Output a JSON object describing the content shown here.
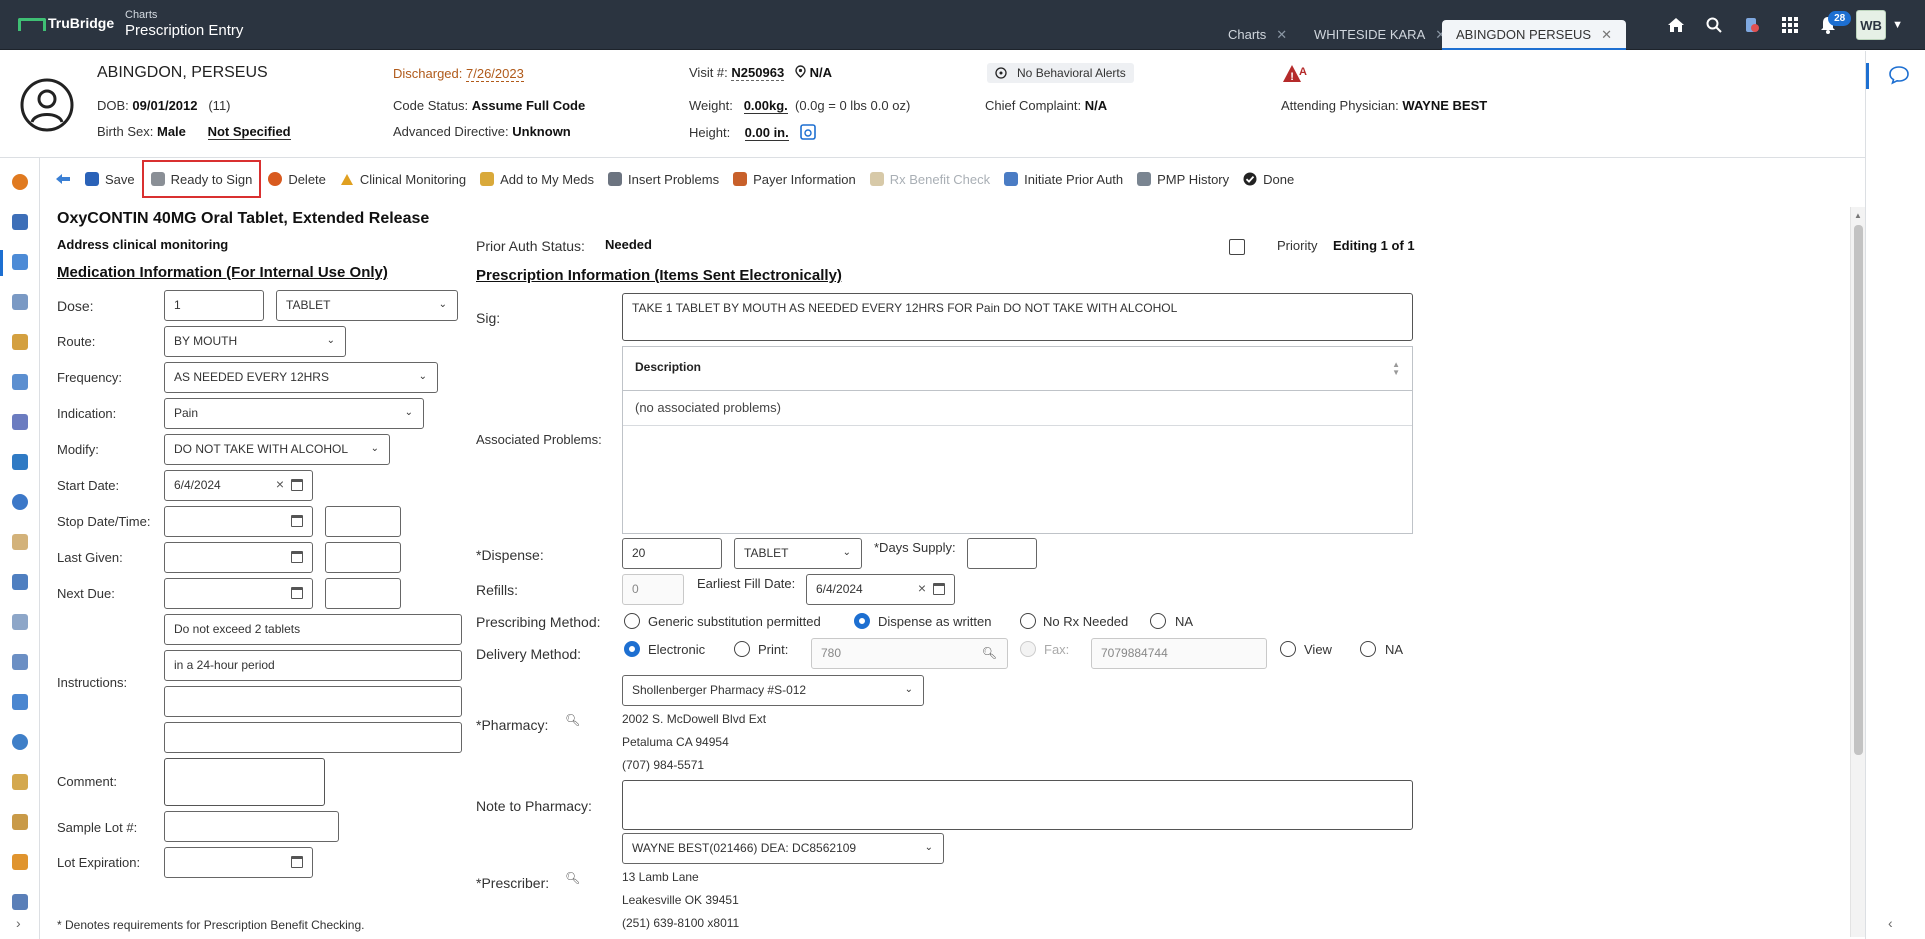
{
  "app": {
    "brand": "TruBridge",
    "module_small": "Charts",
    "module_title": "Prescription Entry"
  },
  "tabs": [
    {
      "label": "Charts"
    },
    {
      "label": "WHITESIDE KARA"
    },
    {
      "label": "ABINGDON PERSEUS",
      "active": true
    }
  ],
  "top_icons": {
    "notifications_count": "28",
    "user_initials": "WB"
  },
  "patient": {
    "last_name": "ABINGDON",
    "first_name": ", PERSEUS",
    "dob_label": "DOB:",
    "dob": "09/01/2012",
    "age": "(11)",
    "birth_sex_label": "Birth Sex:",
    "birth_sex": "Male",
    "gender": "Not Specified",
    "discharged_label": "Discharged:",
    "discharged_date": "7/26/2023",
    "code_status_label": "Code Status:",
    "code_status": "Assume Full Code",
    "adv_directive_label": "Advanced Directive:",
    "adv_directive": "Unknown",
    "visit_label": "Visit #:",
    "visit": "N250963",
    "location": "N/A",
    "weight_label": "Weight:",
    "weight": "0.00kg.",
    "weight_note": "(0.0g = 0 lbs 0.0 oz)",
    "height_label": "Height:",
    "height": "0.00 in.",
    "behavioral": "No Behavioral Alerts",
    "chief_complaint_label": "Chief Complaint:",
    "chief_complaint": "N/A",
    "attending_label": "Attending Physician:",
    "attending": "WAYNE BEST"
  },
  "toolbar": [
    {
      "label": "Save",
      "name": "save-button",
      "color": "#2a62b8"
    },
    {
      "label": "Ready to Sign",
      "name": "ready-to-sign-button",
      "color": "#8a8f96",
      "highlight": true
    },
    {
      "label": "Delete",
      "name": "delete-button",
      "color": "#d85a1f"
    },
    {
      "label": "Clinical Monitoring",
      "name": "clinical-monitoring-button",
      "color": "#e0a020"
    },
    {
      "label": "Add to My Meds",
      "name": "add-to-my-meds-button",
      "color": "#d9a93a"
    },
    {
      "label": "Insert Problems",
      "name": "insert-problems-button",
      "color": "#6c7480"
    },
    {
      "label": "Payer Information",
      "name": "payer-information-button",
      "color": "#c8602a"
    },
    {
      "label": "Rx Benefit Check",
      "name": "rx-benefit-check-button",
      "color": "#d7c9a8",
      "disabled": true
    },
    {
      "label": "Initiate Prior Auth",
      "name": "initiate-prior-auth-button",
      "color": "#4a7cc4"
    },
    {
      "label": "PMP History",
      "name": "pmp-history-button",
      "color": "#7a8591"
    },
    {
      "label": "Done",
      "name": "done-button",
      "color": "#222"
    }
  ],
  "rx": {
    "drug_title": "OxyCONTIN 40MG Oral Tablet, Extended Release",
    "monitor_note": "Address clinical monitoring",
    "prior_auth_label": "Prior Auth Status:",
    "prior_auth_value": "Needed",
    "priority_label": "Priority",
    "editing": "Editing 1 of 1",
    "med_section": "Medication Information (For Internal Use Only)",
    "presc_section": "Prescription Information (Items Sent Electronically)",
    "dose_label": "Dose:",
    "dose_value": "1",
    "dose_unit": "TABLET",
    "route_label": "Route:",
    "route": "BY MOUTH",
    "frequency_label": "Frequency:",
    "frequency": "AS NEEDED EVERY 12HRS",
    "indication_label": "Indication:",
    "indication": "Pain",
    "modify_label": "Modify:",
    "modify": "DO NOT TAKE WITH ALCOHOL",
    "start_label": "Start Date:",
    "start_date": "6/4/2024",
    "stop_label": "Stop Date/Time:",
    "last_given_label": "Last Given:",
    "next_due_label": "Next Due:",
    "instructions_label": "Instructions:",
    "instructions": [
      "Do not exceed 2 tablets",
      "in a 24-hour period",
      "",
      ""
    ],
    "comment_label": "Comment:",
    "sample_lot_label": "Sample Lot #:",
    "lot_exp_label": "Lot Expiration:",
    "sig_label": "Sig:",
    "sig": "TAKE 1 TABLET BY MOUTH AS NEEDED EVERY 12HRS FOR Pain DO NOT TAKE WITH ALCOHOL",
    "assoc_label": "Associated Problems:",
    "assoc_header": "Description",
    "assoc_empty": "(no associated problems)",
    "dispense_label": "*Dispense:",
    "dispense_qty": "20",
    "dispense_unit": "TABLET",
    "days_supply_label": "*Days Supply:",
    "refills_label": "Refills:",
    "refills": "0",
    "earliest_fill_label": "Earliest Fill Date:",
    "earliest_fill": "6/4/2024",
    "presc_method_label": "Prescribing Method:",
    "presc_methods": [
      "Generic substitution permitted",
      "Dispense as written",
      "No Rx Needed",
      "NA"
    ],
    "delivery_label": "Delivery Method:",
    "delivery_electronic": "Electronic",
    "delivery_print": "Print:",
    "print_value": "780",
    "delivery_fax": "Fax:",
    "fax_value": "7079884744",
    "delivery_view": "View",
    "delivery_na": "NA",
    "pharmacy_label": "*Pharmacy:",
    "pharmacy": "Shollenberger Pharmacy #S-012",
    "pharmacy_addr1": "2002 S. McDowell Blvd Ext",
    "pharmacy_addr2": "Petaluma    CA    94954",
    "pharmacy_phone": "(707) 984-5571",
    "note_label": "Note to Pharmacy:",
    "prescriber_label": "*Prescriber:",
    "prescriber": "WAYNE BEST(021466)     DEA: DC8562109",
    "prescriber_addr1": "13 Lamb Lane",
    "prescriber_addr2": "Leakesville    OK    39451",
    "prescriber_phone": "(251) 639-8100 x8011",
    "footnote": "* Denotes requirements for Prescription Benefit Checking."
  }
}
